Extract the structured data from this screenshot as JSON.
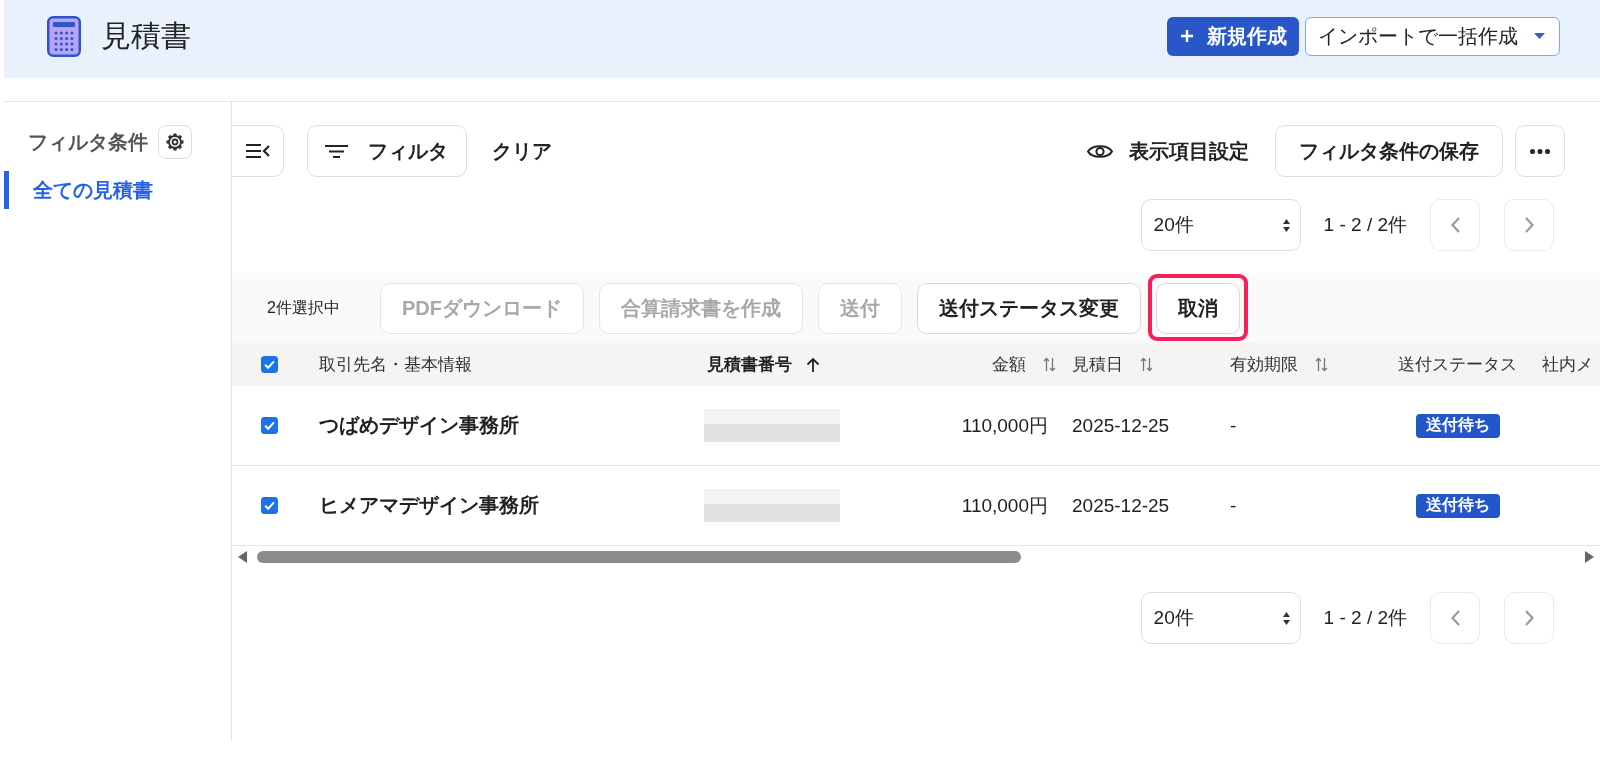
{
  "header": {
    "title": "見積書",
    "new_button": "新規作成",
    "import_dropdown": "インポートで一括作成"
  },
  "sidebar": {
    "heading": "フィルタ条件",
    "items": [
      {
        "label": "全ての見積書",
        "selected": true
      }
    ]
  },
  "toolbar": {
    "filter_button": "フィルタ",
    "clear_link": "クリア",
    "view_settings": "表示項目設定",
    "save_button": "フィルタ条件の保存"
  },
  "pagination_top": {
    "per_page": "20件",
    "range": "1 - 2 / 2件",
    "prev_disabled": true,
    "next_disabled": true
  },
  "bulk_bar": {
    "selection_count": "2件選択中",
    "buttons": [
      {
        "label": "PDFダウンロード",
        "disabled": true,
        "highlighted": false
      },
      {
        "label": "合算請求書を作成",
        "disabled": true,
        "highlighted": false
      },
      {
        "label": "送付",
        "disabled": true,
        "highlighted": false
      },
      {
        "label": "送付ステータス変更",
        "disabled": false,
        "highlighted": false
      },
      {
        "label": "取消",
        "disabled": false,
        "highlighted": true
      }
    ]
  },
  "table": {
    "select_all_checked": true,
    "columns": [
      {
        "kind": "name",
        "label": "取引先名・基本情報",
        "sortable": false,
        "sorted": false
      },
      {
        "kind": "number",
        "label": "見積書番号",
        "sortable": true,
        "sorted": true
      },
      {
        "kind": "amount",
        "label": "金額",
        "sortable": true,
        "sorted": false
      },
      {
        "kind": "date",
        "label": "見積日",
        "sortable": true,
        "sorted": false
      },
      {
        "kind": "expiry",
        "label": "有効期限",
        "sortable": true,
        "sorted": false
      },
      {
        "kind": "status",
        "label": "送付ステータス",
        "sortable": false,
        "sorted": false
      },
      {
        "kind": "memo",
        "label": "社内メ",
        "sortable": false,
        "sorted": false
      }
    ],
    "rows": [
      {
        "checked": true,
        "client": "つばめデザイン事務所",
        "amount": "110,000円",
        "issue_date": "2025-12-25",
        "expiry": "-",
        "status": "送付待ち"
      },
      {
        "checked": true,
        "client": "ヒメアマデザイン事務所",
        "amount": "110,000円",
        "issue_date": "2025-12-25",
        "expiry": "-",
        "status": "送付待ち"
      }
    ]
  },
  "pagination_bottom": {
    "per_page": "20件",
    "range": "1 - 2 / 2件",
    "prev_disabled": true,
    "next_disabled": true
  }
}
